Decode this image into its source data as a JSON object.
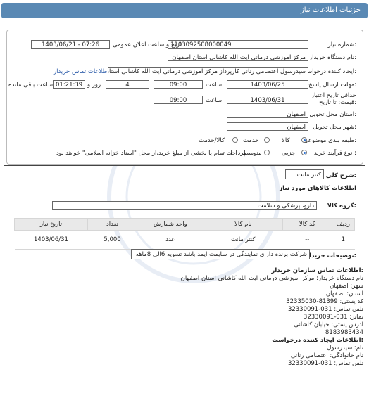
{
  "title": "جزئیات اطلاعات نیاز",
  "fields": {
    "need_number_label": "شماره نیاز:",
    "need_number": "1103092508000049",
    "announce_label": "تاریخ و ساعت اعلان عمومی:",
    "announce_value": "1403/06/21 - 07:26",
    "buyer_label": "نام دستگاه خریدار:",
    "buyer_value": "مرکز اموزشی درمانی ایت الله کاشانی استان اصفهان",
    "creator_label": "ایجاد کننده درخواست:",
    "creator_value": "سیدرسول اعتصامی رنانی کارپرداز مرکز اموزشی درمانی ایت الله کاشانی استان",
    "contact_link": "اطلاعات تماس خریدار",
    "reply_label": "مهلت ارسال پاسخ: تا تاریخ:",
    "reply_date": "1403/06/25",
    "time_word": "ساعت",
    "reply_time": "09:00",
    "days_count": "4",
    "days_word": "روز و",
    "remaining_time": "01:21:39",
    "remaining_label": "ساعت باقی مانده",
    "validity_label_1": "حداقل تاریخ اعتبار",
    "validity_label_2": "قیمت: تا تاریخ:",
    "validity_date": "1403/06/31",
    "validity_time": "09:00",
    "province_label": "استان محل تحویل:",
    "province_value": "اصفهان",
    "city_label": "شهر محل تحویل:",
    "city_value": "اصفهان",
    "category_label": "طبقه بندی موضوعی:",
    "cat_goods": "کالا",
    "cat_service": "خدمت",
    "cat_goods_service": "کالا/خدمت",
    "process_label": "نوع فرآیند خرید :",
    "proc_partial": "جزیی",
    "proc_medium": "متوسط",
    "payment_note": "پرداخت تمام یا بخشی از مبلغ خرید،از محل \"اسناد خزانه اسلامی\" خواهد بود."
  },
  "need_desc_label": "شرح کلی نیاز:",
  "need_desc_value": "کنتر مانت",
  "goods_info_heading": "اطلاعات کالاهای مورد نیاز",
  "goods_group_label": "گروه کالا:",
  "goods_group_value": "دارو، پزشکی و سلامت",
  "table": {
    "headers": [
      "ردیف",
      "کد کالا",
      "نام کالا",
      "واحد شمارش",
      "تعداد",
      "تاریخ نیاز"
    ],
    "rows": [
      {
        "row": "1",
        "code": "--",
        "name": "کنتر مانت",
        "unit": "عدد",
        "qty": "5,000",
        "date": "1403/06/31"
      }
    ]
  },
  "buyer_notes_label": "توضیحات خریدار:",
  "buyer_notes_value": "شرکت برنده دارای نمایندگی در سایمت ایمد باشد تسویه 6الی 8ماهه",
  "contact": {
    "heading": "اطلاعات تماس سازمان خریدار:",
    "org_line": "نام دستگاه خریدار: مرکز اموزشی درمانی ایت الله کاشانی استان اصفهان",
    "city_line": "شهر: اصفهان",
    "province_line": "استان: اصفهان",
    "postal_line": "کد پستی: 81399-32335030",
    "phone_line": "تلفن تماس: 031-32330091",
    "fax_line": "نمابر: 031-32330091",
    "address_line": "آدرس پستی: خیابان کاشانی",
    "phone2_line": "8183983434",
    "creator_heading": "اطلاعات ایجاد کننده درخواست:",
    "name_line": "نام: سیدرسول",
    "family_line": "نام خانوادگی: اعتصامی رنانی",
    "creator_phone_line": "تلفن تماس: 031-32330091"
  },
  "colors": {
    "header": "#5a89b4",
    "link": "#2a5aa8"
  }
}
